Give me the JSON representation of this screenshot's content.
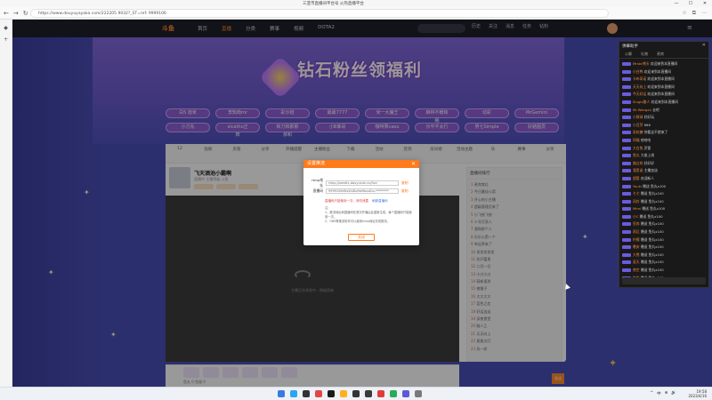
{
  "window": {
    "title": "三亚市直播间平台号 火热直播平台",
    "controls": [
      "—",
      "☐",
      "✕"
    ]
  },
  "browser": {
    "url": "https://www.douyuyayaka.com/222205 9032?_ST=ref: 9999106",
    "nav_icons": [
      "←",
      "→",
      "↻"
    ],
    "tool_icons": [
      "☆",
      "⧉",
      "⋯"
    ]
  },
  "site_nav": {
    "logo": "斗鱼",
    "links": [
      "首页",
      "直播",
      "分类",
      "赛事",
      "视频",
      "DOTA2"
    ],
    "active_index": 1,
    "header_icons": [
      "历史",
      "关注",
      "消息",
      "任务",
      "钻粉"
    ]
  },
  "banner": {
    "title": "钻石粉丝领福利"
  },
  "tags": {
    "row1": [
      "白5 炮米",
      "李知南mr",
      "彩沙炮",
      "最最7777",
      "米一大魔王",
      "麻林不暖和绳",
      "幼彩",
      "MrGeminl"
    ],
    "row2": [
      "小刀先",
      "vlcatho正牌",
      "和刀和那那那和",
      "小B谁哥",
      "咖啡果caou",
      "沙平不太行",
      "男七Simple",
      "好菇图员"
    ]
  },
  "stream": {
    "toolbar_items": [
      "12",
      "钻粉",
      "房管",
      "分享",
      "开播提醒",
      "主播粉丝",
      "下载",
      "活动",
      "签到",
      "房间榜",
      "活动主题",
      "乐",
      "赛事",
      "分享"
    ],
    "anchor_name": "飞天酒池小霸啊",
    "anchor_meta": "直播中  主播等级  斗鱼",
    "video_message": "主播正在休息中，稍候再来",
    "right_header": "直播间排行",
    "right_list": [
      {
        "rank": "1",
        "text": "贵宾席位"
      },
      {
        "rank": "2",
        "text": "今日最佳火箭"
      },
      {
        "rank": "3",
        "text": "开心的小主播"
      },
      {
        "rank": "4",
        "text": "超级管理员来了"
      },
      {
        "rank": "5",
        "text": "小飞侠飞侠"
      },
      {
        "rank": "6",
        "text": "十号月亮人"
      },
      {
        "rank": "7",
        "text": "我和那个人"
      },
      {
        "rank": "8",
        "text": "乐乐火箭一个"
      },
      {
        "rank": "9",
        "text": "幸运草来了"
      },
      {
        "rank": "10",
        "text": "发发发发发"
      },
      {
        "rank": "11",
        "text": "花开富贵"
      },
      {
        "rank": "12",
        "text": "二月一日"
      },
      {
        "rank": "13",
        "text": "小刀小刀"
      },
      {
        "rank": "14",
        "text": "萌新报到"
      },
      {
        "rank": "15",
        "text": "夜猫子"
      },
      {
        "rank": "16",
        "text": "大大大大"
      },
      {
        "rank": "17",
        "text": "蓝色之恋"
      },
      {
        "rank": "18",
        "text": "好运连连"
      },
      {
        "rank": "19",
        "text": "深夜食堂"
      },
      {
        "rank": "20",
        "text": "路人乙"
      },
      {
        "rank": "21",
        "text": "天天向上"
      },
      {
        "rank": "22",
        "text": "星星点灯"
      },
      {
        "rank": "23",
        "text": "风一样"
      }
    ],
    "gift_label": "鱼丸 0  鱼翅 0",
    "send_label": "发送"
  },
  "dialog": {
    "title": "设置推流",
    "close": "✕",
    "rtmp_label": "rtmp地址",
    "rtmp_value": "rtmp://sendtc.douyucdn.cn/live",
    "rtmp_copy": "复制",
    "key_label": "直播码",
    "key_value": "9999106rWxZsIDo9wYaouDu=********",
    "key_copy": "复制",
    "warning": "直播码只能使用一次，请勿泄露",
    "warning_link": "刷新直播码",
    "notes": [
      "注：",
      "1、推流地址和直播码在首次开播后会重新生成，每个直播码只能使用一次。",
      "2、OBS等推流软件可以使用rtmp地址完成推流。"
    ],
    "ok": "关闭"
  },
  "chat": {
    "title": "弹幕助手",
    "close": "✕",
    "tabs": [
      "公聊",
      "礼物",
      "贵宾"
    ],
    "messages": [
      {
        "user": "Mrskc铁头",
        "text": "欢迎来到本直播间"
      },
      {
        "user": "小白鸭",
        "text": "欢迎来到本直播间"
      },
      {
        "user": "卡布奇诺",
        "text": "欢迎来到本直播间"
      },
      {
        "user": "天天向上",
        "text": "欢迎来到本直播间"
      },
      {
        "user": "今天好运",
        "text": "欢迎来到本直播间"
      },
      {
        "user": "Single路人",
        "text": "欢迎来到本直播间"
      },
      {
        "user": "Mr.Wangxx",
        "text": "去吧"
      },
      {
        "user": "小胖球",
        "text": "好好玩"
      },
      {
        "user": "小豆芽",
        "text": "666"
      },
      {
        "user": "彩虹糖",
        "text": "你看这不就来了"
      },
      {
        "user": "阿福",
        "text": "哈哈哈"
      },
      {
        "user": "大白兔",
        "text": "厉害"
      },
      {
        "user": "鱼丸",
        "text": "大佬上线"
      },
      {
        "user": "路过的",
        "text": "好好好"
      },
      {
        "user": "我是谁",
        "text": "主播加油"
      },
      {
        "user": "超管",
        "text": "欢迎新人"
      },
      {
        "user": "Yuuki",
        "text": "赠送 鱼丸x100"
      },
      {
        "user": "七七",
        "text": "赠送 鱼丸x100"
      },
      {
        "user": "风铃",
        "text": "赠送 鱼丸x100"
      },
      {
        "user": "Mimi",
        "text": "赠送 鱼丸x100"
      },
      {
        "user": "小C",
        "text": "赠送 鱼丸x100"
      },
      {
        "user": "狂奔",
        "text": "赠送 鱼丸x100"
      },
      {
        "user": "雨后",
        "text": "赠送 鱼丸x100"
      },
      {
        "user": "柠檬",
        "text": "赠送 鱼丸x100"
      },
      {
        "user": "晚安",
        "text": "赠送 鱼丸x100"
      },
      {
        "user": "大熊",
        "text": "赠送 鱼丸x100"
      },
      {
        "user": "夏天",
        "text": "赠送 鱼丸x100"
      },
      {
        "user": "夜空",
        "text": "赠送 鱼丸x100"
      },
      {
        "user": "啦啦",
        "text": "赠送 鱼丸x100"
      }
    ]
  },
  "taskbar": {
    "app_colors": [
      "#3a7be0",
      "#2aa6f0",
      "#333333",
      "#e04848",
      "#1a1a1a",
      "#ffb020",
      "#333333",
      "#3a3a3a",
      "#e03c3c",
      "#2aaa5a",
      "#5a5ad8",
      "#7a7a7a"
    ],
    "tray": [
      "^",
      "中",
      "⊕",
      "🔊"
    ],
    "time": "19:58",
    "date": "2023/4/16"
  }
}
